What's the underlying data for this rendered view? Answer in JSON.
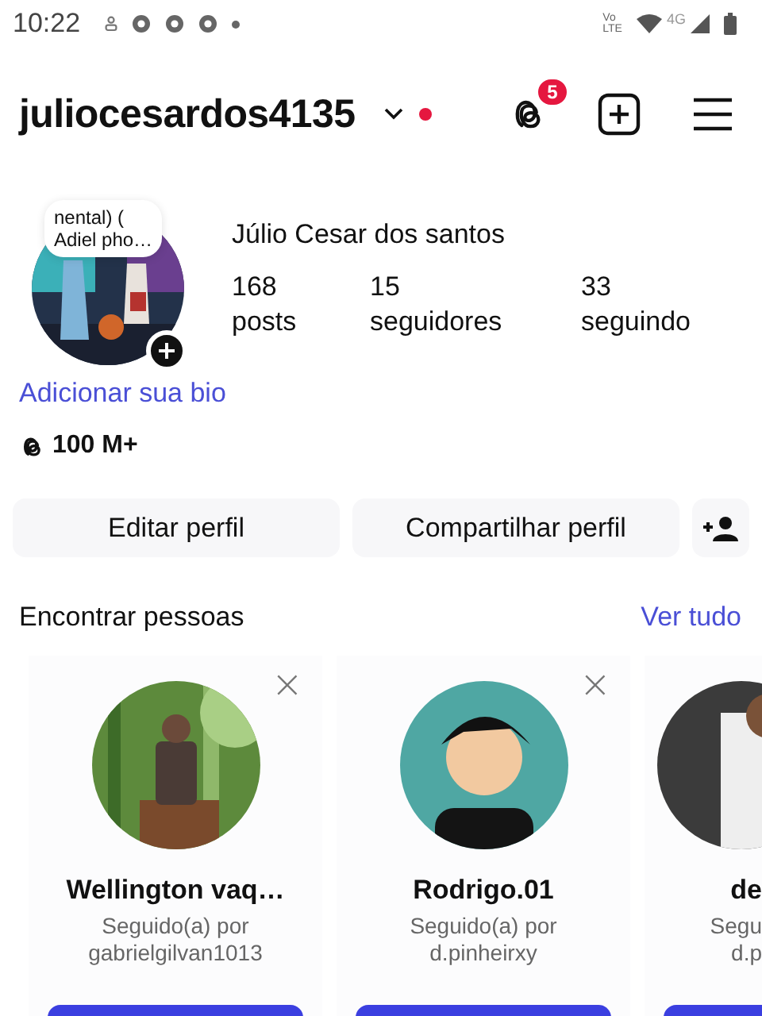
{
  "status_bar": {
    "time": "10:22",
    "volte": [
      "Vo",
      "LTE"
    ],
    "network": "4G"
  },
  "header": {
    "username": "juliocesardos4135",
    "unread_dot": true,
    "threads_badge": "5"
  },
  "profile": {
    "note": [
      "nental) (",
      "Adiel pho…"
    ],
    "name": "Júlio Cesar dos santos",
    "stats": [
      {
        "value": "168",
        "label": "posts"
      },
      {
        "value": "15",
        "label": "seguidores"
      },
      {
        "value": "33",
        "label": "seguindo"
      }
    ],
    "bio_link": "Adicionar sua bio",
    "threads_count": "100 M+"
  },
  "actions": [
    "Editar perfil",
    "Compartilhar perfil"
  ],
  "suggestions": {
    "title": "Encontrar pessoas",
    "see_all": "Ver tudo",
    "cards": [
      {
        "name": "Wellington vaq…",
        "followed_by": [
          "Seguido(a) por",
          "gabrielgilvan1013"
        ],
        "dismiss": "×"
      },
      {
        "name": "Rodrigo.01",
        "followed_by": [
          "Seguido(a) por",
          "d.pinheirxy"
        ],
        "dismiss": "×"
      },
      {
        "name": "de",
        "followed_by": [
          "Segu",
          "d.p"
        ]
      }
    ]
  }
}
